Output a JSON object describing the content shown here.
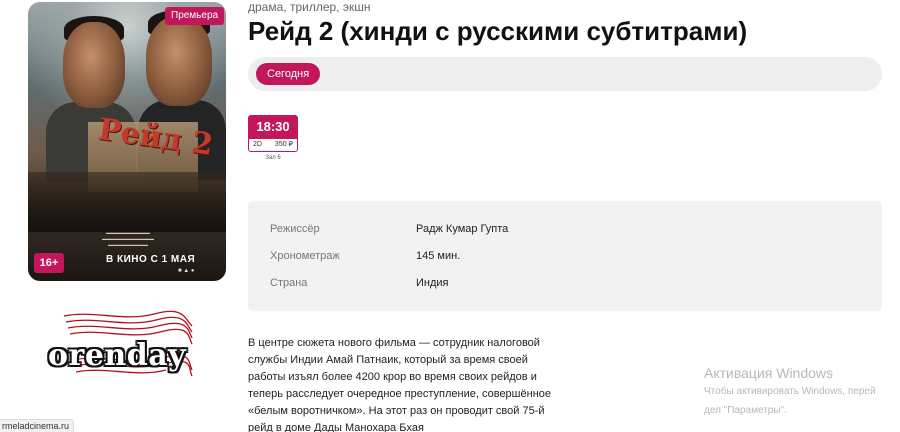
{
  "poster": {
    "badge_premiere": "Премьера",
    "age_rating": "16+",
    "art_title": "Рейд 2",
    "release_line": "В КИНО С 1 МАЯ"
  },
  "logo": {
    "text": "orenday"
  },
  "movie": {
    "genres": "драма, триллер, экшн",
    "title": "Рейд 2 (хинди с русскими субтитрами)"
  },
  "dates": {
    "selected": "Сегодня"
  },
  "sessions": [
    {
      "time": "18:30",
      "format": "2D",
      "price": "350 ₽",
      "hall": "Зал 6"
    }
  ],
  "info": [
    {
      "label": "Режиссёр",
      "value": "Радж Кумар Гупта"
    },
    {
      "label": "Хронометраж",
      "value": "145 мин."
    },
    {
      "label": "Страна",
      "value": "Индия"
    }
  ],
  "description": "В центре сюжета нового фильма — сотрудник налоговой службы Индии Амай Патнаик, который за время своей работы изъял более 4200 крор во время своих рейдов и теперь расследует очередное преступление, совершённое «белым воротничком». На этот раз он проводит свой 75-й рейд в доме Дады Манохара Бхая",
  "windows_watermark": {
    "line1": "Активация Windows",
    "line2": "Чтобы активировать Windows, перей",
    "line3": "дел \"Параметры\"."
  },
  "status_url": "rmeladcinema.ru",
  "colors": {
    "accent": "#c2185b"
  }
}
